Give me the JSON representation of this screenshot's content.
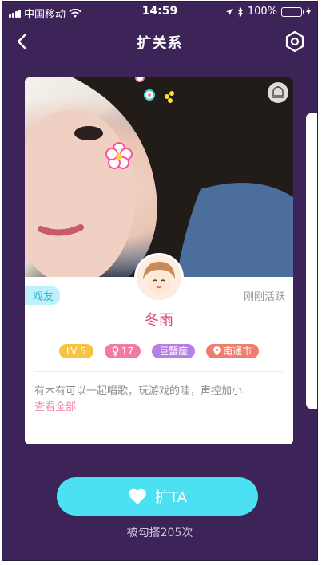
{
  "status_bar": {
    "carrier": "中国移动",
    "time": "14:59",
    "battery": "100%",
    "battery_level": 1.0
  },
  "nav": {
    "title": "扩关系"
  },
  "card": {
    "relation_tag": "戏友",
    "active_status": "刚刚活跃",
    "name": "冬雨",
    "badges": [
      {
        "label": "LV 5",
        "color": "#f6c343"
      },
      {
        "label": "17",
        "color": "#f37aa3"
      },
      {
        "label": "巨蟹座",
        "color": "#b77ee6"
      },
      {
        "label": "南通市",
        "color": "#f07c6e"
      }
    ],
    "intro": "有木有可以一起唱歌，玩游戏的哇，声控加小",
    "see_all": "查看全部"
  },
  "action": {
    "button_label": "扩TA",
    "count_text": "被勾搭205次"
  }
}
